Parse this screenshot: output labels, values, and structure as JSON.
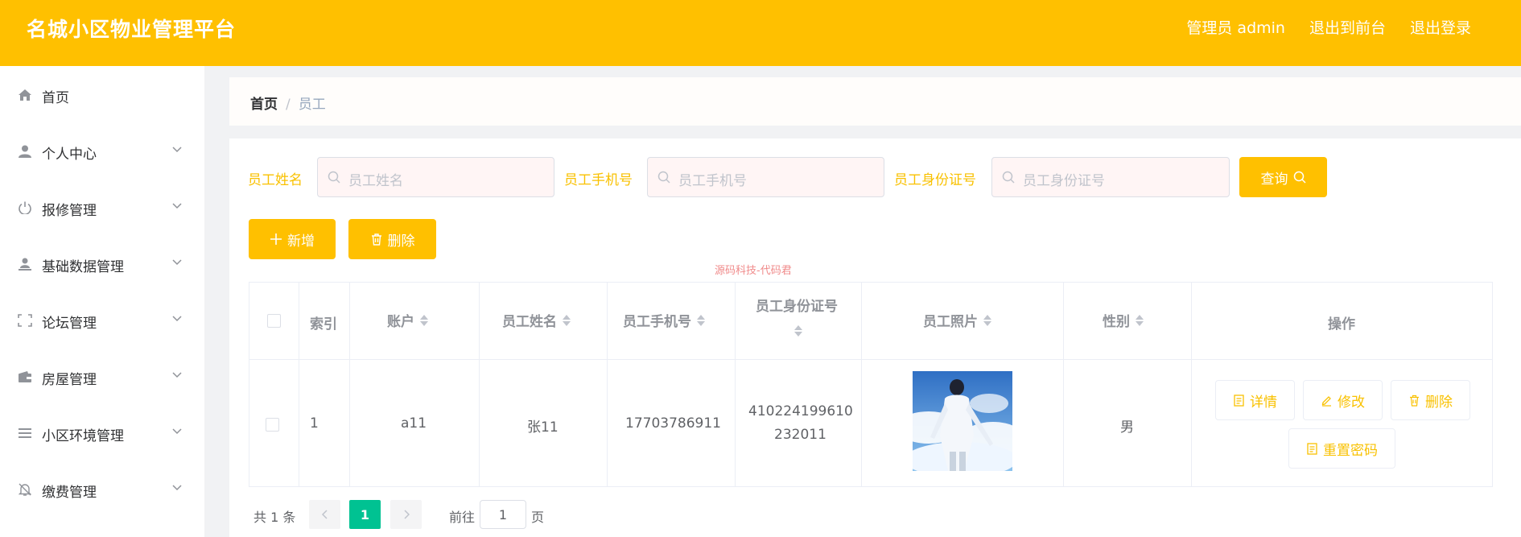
{
  "header": {
    "title": "名城小区物业管理平台",
    "user": "管理员 admin",
    "front_link": "退出到前台",
    "logout_link": "退出登录"
  },
  "sidebar": {
    "items": [
      {
        "label": "首页",
        "icon": "home-icon"
      },
      {
        "label": "个人中心",
        "icon": "user-icon"
      },
      {
        "label": "报修管理",
        "icon": "power-icon"
      },
      {
        "label": "基础数据管理",
        "icon": "user-stamp-icon"
      },
      {
        "label": "论坛管理",
        "icon": "fullscreen-icon"
      },
      {
        "label": "房屋管理",
        "icon": "wallet-icon"
      },
      {
        "label": "小区环境管理",
        "icon": "list-icon"
      },
      {
        "label": "缴费管理",
        "icon": "bell-off-icon"
      }
    ]
  },
  "breadcrumb": {
    "home": "首页",
    "separator": "/",
    "current": "员工"
  },
  "search": {
    "name_label": "员工姓名",
    "name_placeholder": "员工姓名",
    "phone_label": "员工手机号",
    "phone_placeholder": "员工手机号",
    "id_label": "员工身份证号",
    "id_placeholder": "员工身份证号",
    "query_button": "查询"
  },
  "actions": {
    "add_button": "新增",
    "delete_button": "删除"
  },
  "watermark": "源码科技-代码君",
  "table": {
    "columns": {
      "index": "索引",
      "account": "账户",
      "name": "员工姓名",
      "phone": "员工手机号",
      "id_card": "员工身份证号",
      "photo": "员工照片",
      "gender": "性别",
      "actions": "操作"
    },
    "rows": [
      {
        "index": "1",
        "account": "a11",
        "name": "张11",
        "phone": "17703786911",
        "id_card_line1": "410224199610",
        "id_card_line2": "232011",
        "gender": "男",
        "detail_button": "详情",
        "edit_button": "修改",
        "delete_button": "删除",
        "reset_button": "重置密码"
      }
    ]
  },
  "pagination": {
    "total": "共 1 条",
    "current_page": "1",
    "goto_label": "前往",
    "goto_value": "1",
    "page_suffix": "页"
  },
  "colors": {
    "accent": "#ffc000",
    "active_page": "#00c292"
  }
}
